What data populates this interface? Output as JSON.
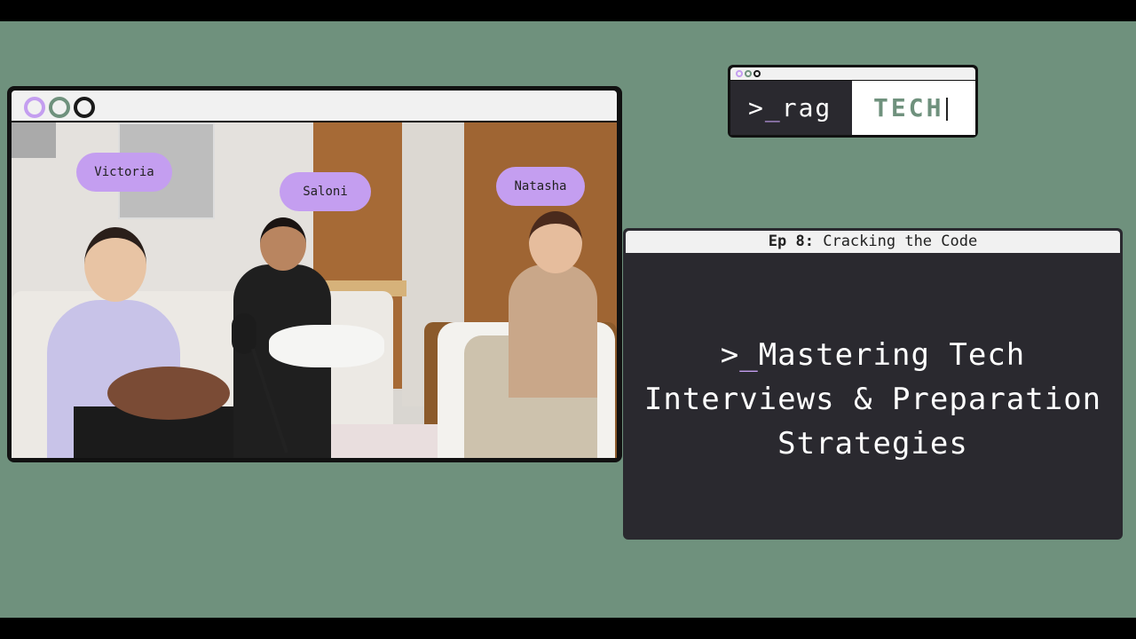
{
  "logo": {
    "prompt": ">",
    "underscore": "_",
    "left": "rag",
    "right": "TECH"
  },
  "speakers": [
    "Victoria",
    "Saloni",
    "Natasha"
  ],
  "episode": {
    "number_label": "Ep 8:",
    "subtitle": "Cracking the Code",
    "title_prefix": ">",
    "title_underscore": "_",
    "title_line1": "Mastering Tech",
    "title_line2": "Interviews & Preparation",
    "title_line3": "Strategies"
  },
  "colors": {
    "background": "#6f917d",
    "accent": "#c49ef0",
    "panel": "#2a292f"
  }
}
